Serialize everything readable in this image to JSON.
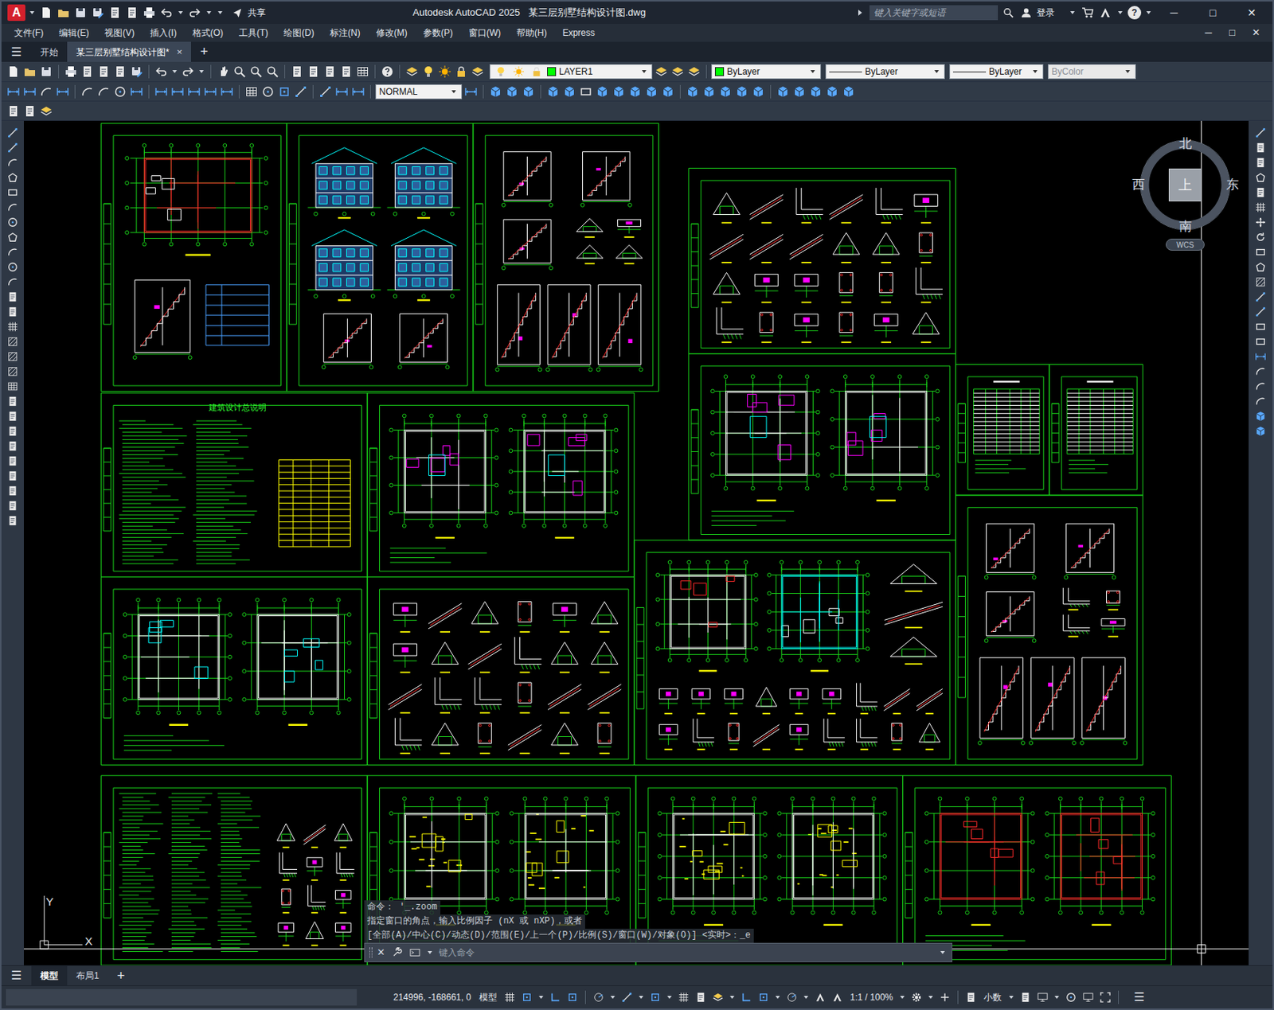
{
  "window": {
    "app_logo": "A",
    "title": "Autodesk AutoCAD 2025   某三层别墅结构设计图.dwg",
    "share": "共享",
    "login": "登录",
    "help": "?",
    "controls": [
      "─",
      "□",
      "✕"
    ]
  },
  "search": {
    "placeholder": "键入关键字或短语"
  },
  "menu": {
    "items": [
      "文件(F)",
      "编辑(E)",
      "视图(V)",
      "插入(I)",
      "格式(O)",
      "工具(T)",
      "绘图(D)",
      "标注(N)",
      "修改(M)",
      "参数(P)",
      "窗口(W)",
      "帮助(H)",
      "Express"
    ],
    "doc_controls": [
      "─",
      "□",
      "✕"
    ]
  },
  "doc_tabs": {
    "menu": "☰",
    "close": "×",
    "add": "+",
    "tabs": [
      {
        "label": "开始",
        "selected": false,
        "closable": false
      },
      {
        "label": "某三层别墅结构设计图*",
        "selected": true,
        "closable": true
      }
    ]
  },
  "properties": {
    "layer": {
      "name": "LAYER1",
      "color": "#00ff00"
    },
    "color": {
      "label": "ByLayer",
      "swatch": "#00ff00"
    },
    "linetype": "ByLayer",
    "lineweight": "ByLayer",
    "plot_style": {
      "label": "ByColor",
      "disabled": true
    },
    "dim_style": "NORMAL"
  },
  "viewcube": {
    "north": "北",
    "south": "南",
    "west": "西",
    "east": "东",
    "top": "上",
    "wcs": "WCS"
  },
  "ucs": {
    "x": "X",
    "y": "Y"
  },
  "drawing": {
    "title_text": "建筑设计总说明"
  },
  "command_line": {
    "lines": [
      "命令： '_.zoom",
      "指定窗口的角点，输入比例因子 (nX 或 nXP)，或者",
      "[全部(A)/中心(C)/动态(D)/范围(E)/上一个(P)/比例(S)/窗口(W)/对象(O)] <实时>：_e"
    ],
    "close": "✕",
    "placeholder": "键入命令"
  },
  "layout_tabs": {
    "menu": "☰",
    "add": "+",
    "tabs": [
      {
        "label": "模型",
        "selected": true
      },
      {
        "label": "布局1",
        "selected": false
      }
    ]
  },
  "status_bar": {
    "coordinates": "214996, -168661, 0",
    "space": "模型",
    "scale": "1:1 / 100%",
    "units": "小数"
  }
}
